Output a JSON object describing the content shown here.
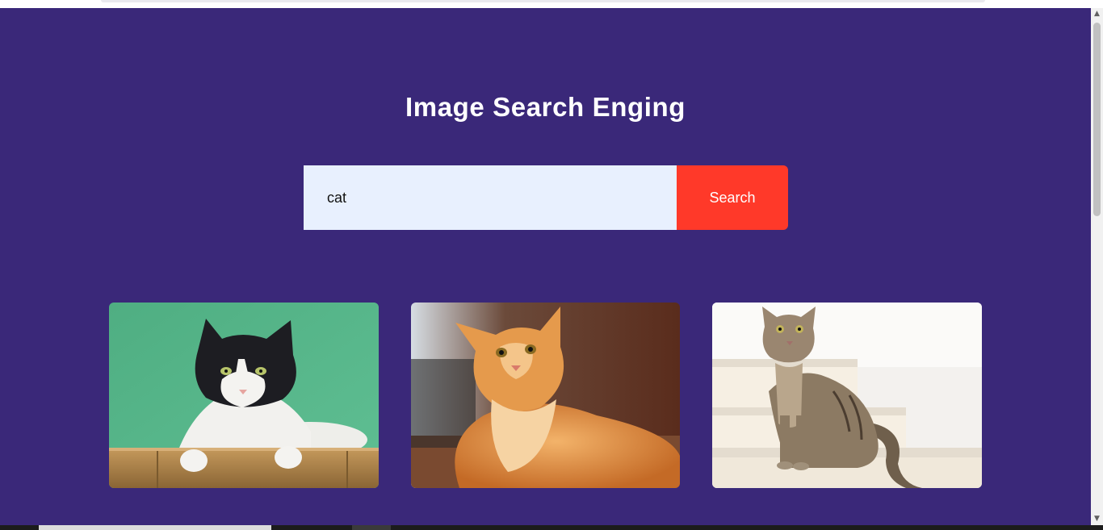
{
  "page": {
    "title": "Image Search Enging",
    "background_color": "#3a2879"
  },
  "search": {
    "value": "cat",
    "button_label": "Search",
    "button_color": "#ff3929",
    "input_background": "#e8f0fe"
  },
  "results": [
    {
      "subject": "black-and-white cat leaning over bamboo ledge, green background"
    },
    {
      "subject": "orange long-haired cat lying down looking up"
    },
    {
      "subject": "tabby cat sitting on white stairs"
    }
  ]
}
